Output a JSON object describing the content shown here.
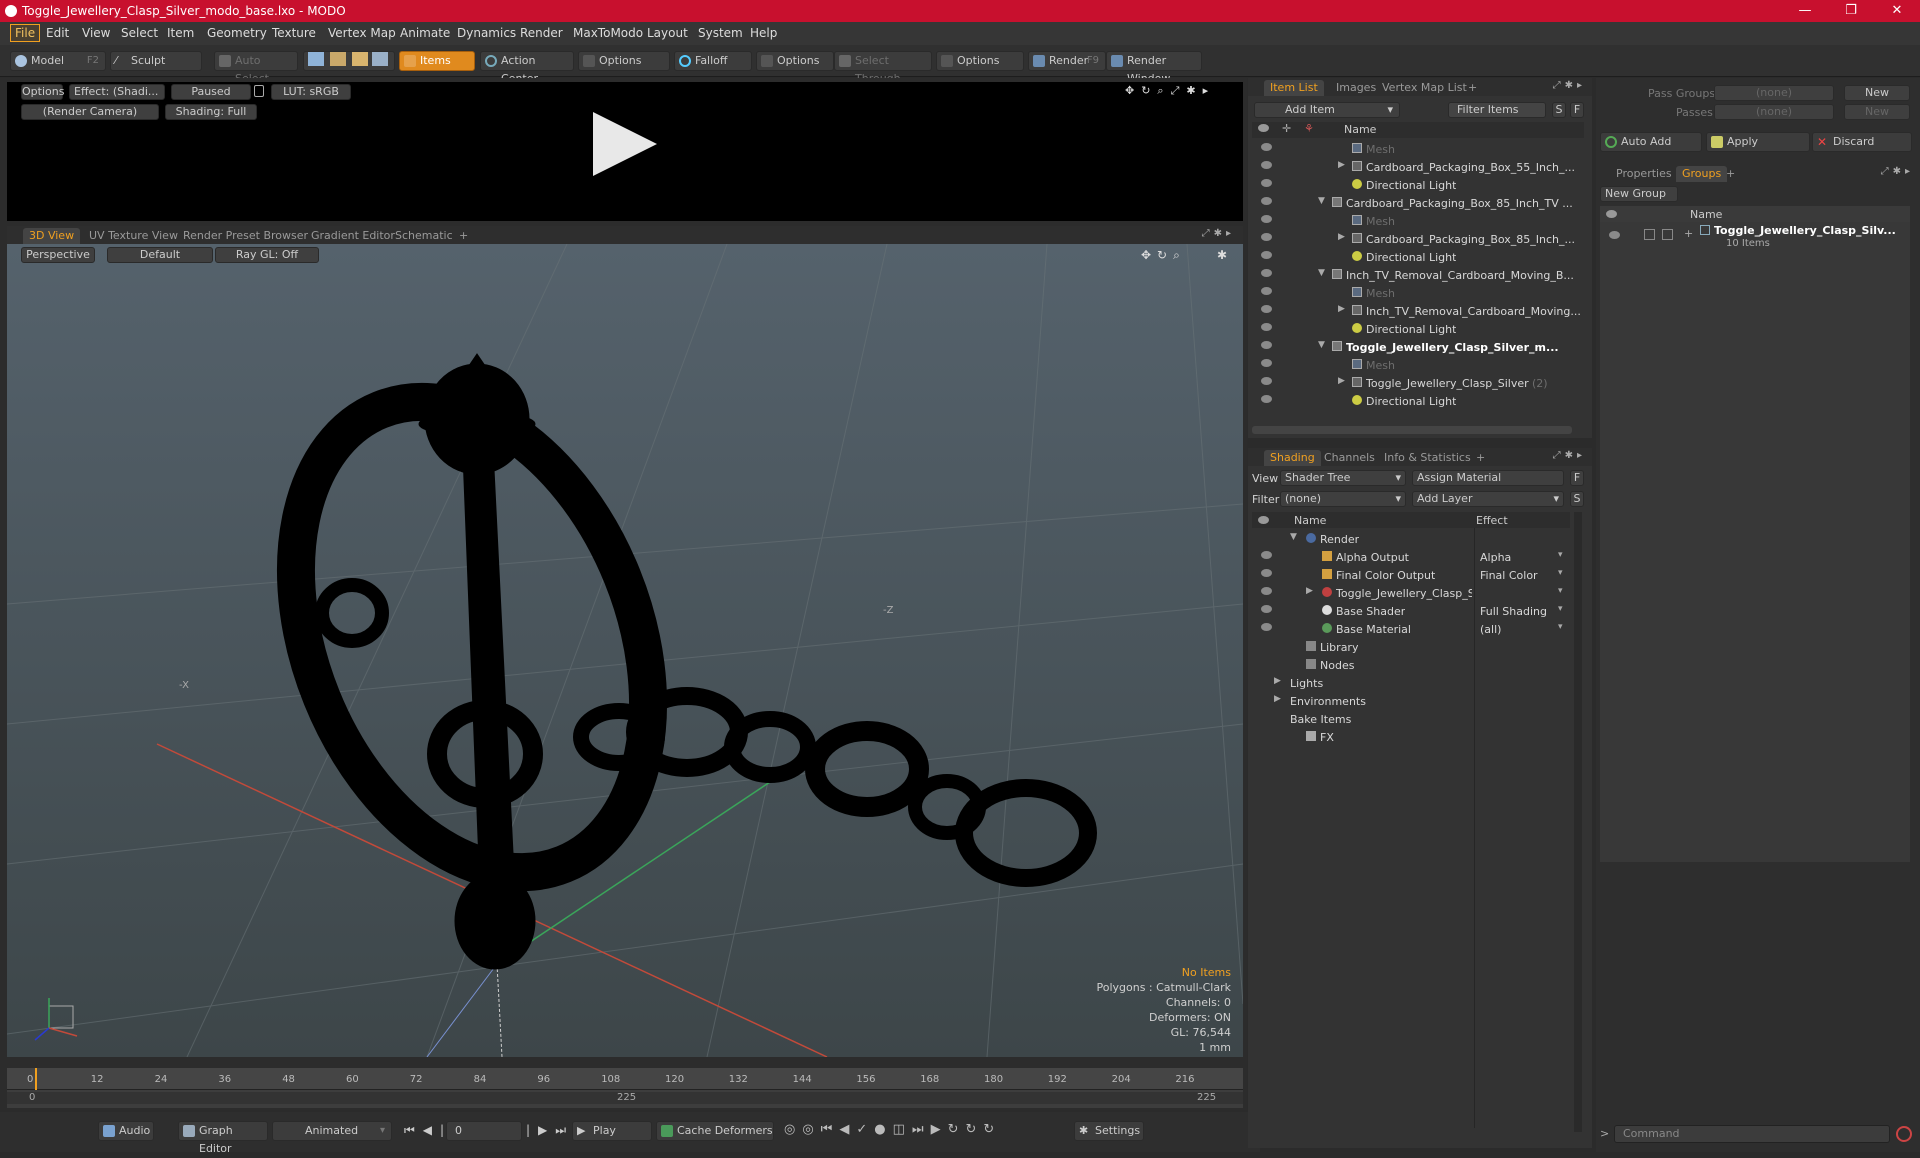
{
  "window": {
    "title": "Toggle_Jewellery_Clasp_Silver_modo_base.lxo - MODO",
    "controls": [
      "—",
      "❐",
      "✕"
    ]
  },
  "menu": [
    "File",
    "Edit",
    "View",
    "Select",
    "Item",
    "Geometry",
    "Texture",
    "Vertex Map",
    "Animate",
    "Dynamics",
    "Render",
    "MaxToModo",
    "Layout",
    "System",
    "Help"
  ],
  "toolbar": {
    "model": "Model",
    "model_key": "F2",
    "sculpt": "Sculpt",
    "auto_select": "Auto Select",
    "items": "Items",
    "action_center": "Action Center",
    "options1": "Options",
    "falloff": "Falloff",
    "options2": "Options",
    "select_through": "Select Through",
    "options3": "Options",
    "render": "Render",
    "render_key": "F9",
    "render_window": "Render Window"
  },
  "preview": {
    "options": "Options",
    "effect": "Effect: (Shadi...",
    "paused": "Paused",
    "lut": "LUT: sRGB",
    "camera": "(Render Camera)",
    "shading": "Shading: Full"
  },
  "view_tabs": [
    "3D View",
    "UV Texture View",
    "Render Preset Browser",
    "Gradient Editor",
    "Schematic",
    "+"
  ],
  "viewport": {
    "perspective": "Perspective",
    "default": "Default",
    "raygl": "Ray GL: Off",
    "info": {
      "no_items": "No Items",
      "polygons": "Polygons : Catmull-Clark",
      "channels": "Channels: 0",
      "deformers": "Deformers: ON",
      "gl": "GL: 76,544",
      "unit": "1 mm"
    },
    "axis_label_z": "-Z",
    "axis_label_x": "-X"
  },
  "item_list": {
    "tabs": [
      "Item List",
      "Images",
      "Vertex Map List",
      "+"
    ],
    "add_item": "Add Item",
    "filter": "Filter Items",
    "s": "S",
    "f": "F",
    "col_name": "Name",
    "rows": [
      {
        "text": "Mesh",
        "indent": 3,
        "kind": "mesh",
        "dim": true
      },
      {
        "text": "Cardboard_Packaging_Box_55_Inch_...",
        "indent": 3,
        "kind": "group",
        "arrow": "▶"
      },
      {
        "text": "Directional Light",
        "indent": 3,
        "kind": "light"
      },
      {
        "text": "Cardboard_Packaging_Box_85_Inch_TV ...",
        "indent": 1,
        "kind": "scene",
        "arrow": "▼"
      },
      {
        "text": "Mesh",
        "indent": 3,
        "kind": "mesh",
        "dim": true
      },
      {
        "text": "Cardboard_Packaging_Box_85_Inch_...",
        "indent": 3,
        "kind": "group",
        "arrow": "▶"
      },
      {
        "text": "Directional Light",
        "indent": 3,
        "kind": "light"
      },
      {
        "text": "Inch_TV_Removal_Cardboard_Moving_B...",
        "indent": 1,
        "kind": "scene",
        "arrow": "▼"
      },
      {
        "text": "Mesh",
        "indent": 3,
        "kind": "mesh",
        "dim": true
      },
      {
        "text": "Inch_TV_Removal_Cardboard_Moving...",
        "indent": 3,
        "kind": "group",
        "arrow": "▶"
      },
      {
        "text": "Directional Light",
        "indent": 3,
        "kind": "light"
      },
      {
        "text": "Toggle_Jewellery_Clasp_Silver_m...",
        "indent": 1,
        "kind": "scene",
        "arrow": "▼",
        "bold": true
      },
      {
        "text": "Mesh",
        "indent": 3,
        "kind": "mesh",
        "dim": true
      },
      {
        "text": "Toggle_Jewellery_Clasp_Silver",
        "suffix": "(2)",
        "indent": 3,
        "kind": "group",
        "arrow": "▶"
      },
      {
        "text": "Directional Light",
        "indent": 3,
        "kind": "light"
      }
    ]
  },
  "shading": {
    "tabs": [
      "Shading",
      "Channels",
      "Info & Statistics",
      "+"
    ],
    "view_label": "View",
    "view_value": "Shader Tree",
    "assign_material": "Assign Material",
    "filter_label": "Filter",
    "filter_value": "(none)",
    "add_layer": "Add Layer",
    "f": "F",
    "s": "S",
    "col_name": "Name",
    "col_effect": "Effect",
    "rows": [
      {
        "name": "Render",
        "effect": "",
        "indent": 1,
        "arrow": "▼",
        "kind": "render",
        "eye": false
      },
      {
        "name": "Alpha Output",
        "effect": "Alpha",
        "indent": 2,
        "kind": "output",
        "eye": true
      },
      {
        "name": "Final Color Output",
        "effect": "Final Color",
        "indent": 2,
        "kind": "output",
        "eye": true
      },
      {
        "name": "Toggle_Jewellery_Clasp_Si...",
        "effect": "",
        "indent": 2,
        "arrow": "▶",
        "kind": "mat",
        "eye": true
      },
      {
        "name": "Base Shader",
        "effect": "Full Shading",
        "indent": 2,
        "kind": "shader",
        "eye": true
      },
      {
        "name": "Base Material",
        "effect": "(all)",
        "indent": 2,
        "kind": "basemat",
        "eye": true
      },
      {
        "name": "Library",
        "effect": "",
        "indent": 1,
        "kind": "folder",
        "eye": false
      },
      {
        "name": "Nodes",
        "effect": "",
        "indent": 1,
        "kind": "folder",
        "eye": false
      },
      {
        "name": "Lights",
        "effect": "",
        "indent": 0,
        "arrow": "▶",
        "kind": "none",
        "eye": false
      },
      {
        "name": "Environments",
        "effect": "",
        "indent": 0,
        "arrow": "▶",
        "kind": "none",
        "eye": false
      },
      {
        "name": "Bake Items",
        "effect": "",
        "indent": 0,
        "kind": "none",
        "eye": false
      },
      {
        "name": "FX",
        "effect": "",
        "indent": 1,
        "kind": "fx",
        "eye": false
      }
    ]
  },
  "right_panel": {
    "pass_groups": "Pass Groups",
    "pass_groups_value": "(none)",
    "passes": "Passes",
    "passes_value": "(none)",
    "new": "New",
    "new2": "New",
    "auto_add": "Auto Add",
    "apply": "Apply",
    "discard": "Discard",
    "tabs": [
      "Properties",
      "Groups",
      "+"
    ],
    "new_group": "New Group",
    "col_name": "Name",
    "group_name": "Toggle_Jewellery_Clasp_Silv...",
    "group_count": "10 Items"
  },
  "timeline": {
    "ticks": [
      "0",
      "12",
      "24",
      "36",
      "48",
      "60",
      "72",
      "84",
      "96",
      "108",
      "120",
      "132",
      "144",
      "156",
      "168",
      "180",
      "192",
      "204",
      "216"
    ],
    "range_start": "0",
    "range_mid": "225",
    "range_end": "225"
  },
  "transport": {
    "audio": "Audio",
    "graph_editor": "Graph Editor",
    "animated": "Animated",
    "frame": "0",
    "play": "Play",
    "cache_deformers": "Cache Deformers",
    "settings": "Settings"
  },
  "command": {
    "placeholder": "Command"
  }
}
